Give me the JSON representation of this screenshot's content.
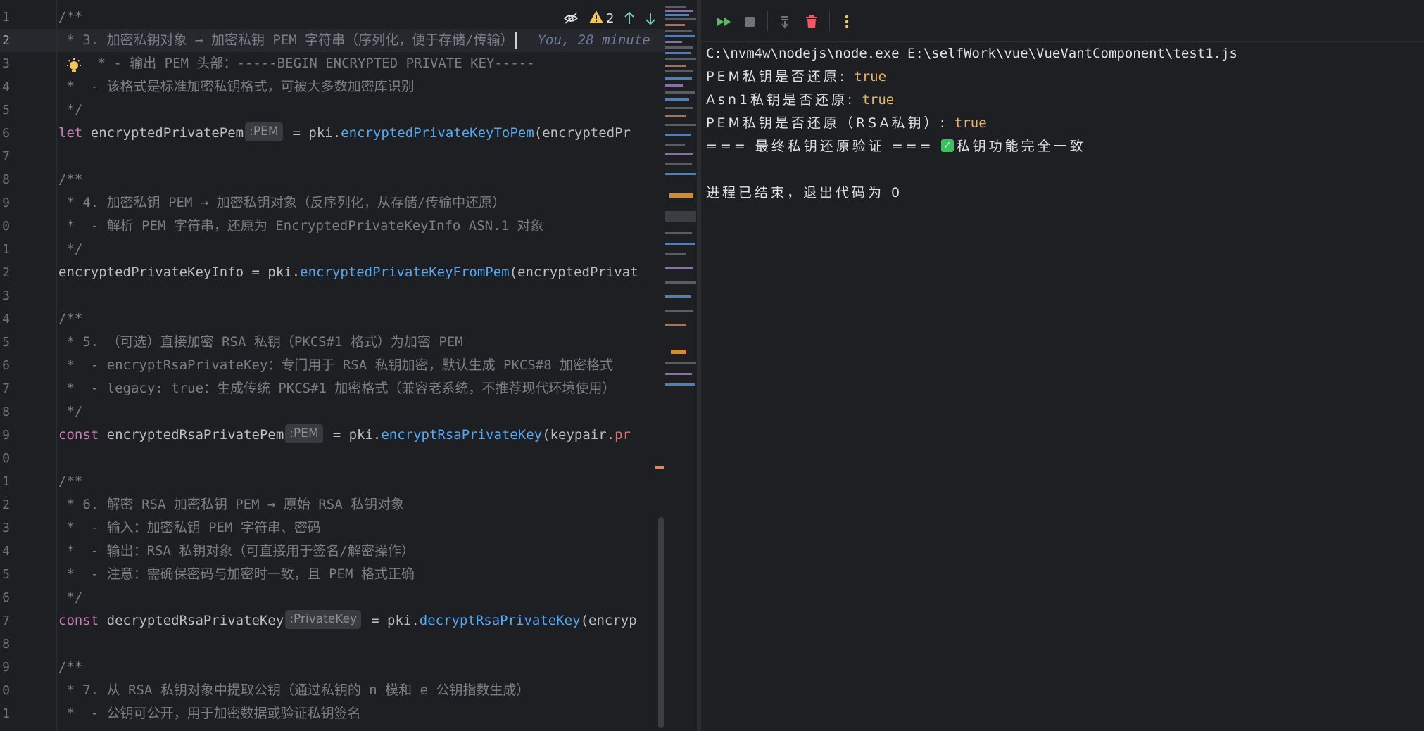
{
  "editor": {
    "line_numbers": [
      "1",
      "2",
      "3",
      "4",
      "5",
      "6",
      "7",
      "8",
      "9",
      "0",
      "1",
      "2",
      "3",
      "4",
      "5",
      "6",
      "7",
      "8",
      "9",
      "0",
      "1",
      "2",
      "3",
      "4",
      "5",
      "6",
      "7",
      "8",
      "9",
      "0",
      "1"
    ],
    "lines": {
      "l1": "/**",
      "l2": " * 3. 加密私钥对象 → 加密私钥 PEM 字符串（序列化，便于存储/传输）",
      "l3": " * - 输出 PEM 头部：-----BEGIN ENCRYPTED PRIVATE KEY-----",
      "l4": " *  - 该格式是标准加密私钥格式，可被大多数加密库识别",
      "l5": " */",
      "l6_kw": "let",
      "l6_var": " encryptedPrivatePem",
      "l6_hint": ":PEM",
      "l6_eq": "= pki.",
      "l6_fn": "encryptedPrivateKeyToPem",
      "l6_rest": "(encryptedPr",
      "l8": "/**",
      "l9": " * 4. 加密私钥 PEM → 加密私钥对象（反序列化，从存储/传输中还原）",
      "l10": " *  - 解析 PEM 字符串，还原为 EncryptedPrivateKeyInfo ASN.1 对象",
      "l11": " */",
      "l12_var": "encryptedPrivateKeyInfo = pki.",
      "l12_fn": "encryptedPrivateKeyFromPem",
      "l12_rest": "(encryptedPrivat",
      "l14": "/**",
      "l15": " * 5. （可选）直接加密 RSA 私钥（PKCS#1 格式）为加密 PEM",
      "l16": " *  - encryptRsaPrivateKey：专门用于 RSA 私钥加密，默认生成 PKCS#8 加密格式",
      "l17": " *  - legacy: true：生成传统 PKCS#1 加密格式（兼容老系统，不推荐现代环境使用）",
      "l18": " */",
      "l19_kw": "const",
      "l19_var": " encryptedRsaPrivatePem",
      "l19_hint": ":PEM",
      "l19_eq": "= pki.",
      "l19_fn": "encryptRsaPrivateKey",
      "l19_rest": "(keypair.",
      "l19_red": "pr",
      "l21": "/**",
      "l22": " * 6. 解密 RSA 加密私钥 PEM → 原始 RSA 私钥对象",
      "l23": " *  - 输入：加密私钥 PEM 字符串、密码",
      "l24": " *  - 输出：RSA 私钥对象（可直接用于签名/解密操作）",
      "l25": " *  - 注意：需确保密码与加密时一致，且 PEM 格式正确",
      "l26": " */",
      "l27_kw": "const",
      "l27_var": " decryptedRsaPrivateKey",
      "l27_hint": ":PrivateKey",
      "l27_eq": "= pki.",
      "l27_fn": "decryptRsaPrivateKey",
      "l27_rest": "(encryp",
      "l29": "/**",
      "l30": " * 7. 从 RSA 私钥对象中提取公钥（通过私钥的 n 模和 e 公钥指数生成）",
      "l31": " *  - 公钥可公开，用于加密数据或验证私钥签名"
    },
    "blame": "You, 28 minute",
    "toolbar": {
      "warning_count": "2"
    }
  },
  "run": {
    "command": "C:\\nvm4w\\nodejs\\node.exe E:\\selfWork\\vue\\VueVantComponent\\test1.js",
    "out1_label": "PEM私钥是否还原: ",
    "out1_value": "true",
    "out2_label": "Asn1私钥是否还原: ",
    "out2_value": "true",
    "out3_label": "PEM私钥是否还原（RSA私钥）: ",
    "out3_value": "true",
    "out4_prefix": "=== 最终私钥还原验证 === ",
    "out4_check": "✓",
    "out4_text": "私钥功能完全一致",
    "exit": "进程已结束，退出代码为 0"
  },
  "colors": {
    "background": "#1e1f22",
    "keyword": "#cf8e6d",
    "function": "#56a8f5",
    "comment": "#7a7e85",
    "true_value": "#e8b36b",
    "stop_red": "#f75464",
    "rerun_green": "#5fb865"
  },
  "icons": [
    "eye-off-icon",
    "warning-icon",
    "arrow-up-icon",
    "arrow-down-icon",
    "bulb-icon",
    "rerun-icon",
    "stop-icon",
    "scroll-end-icon",
    "trash-icon",
    "more-icon"
  ]
}
